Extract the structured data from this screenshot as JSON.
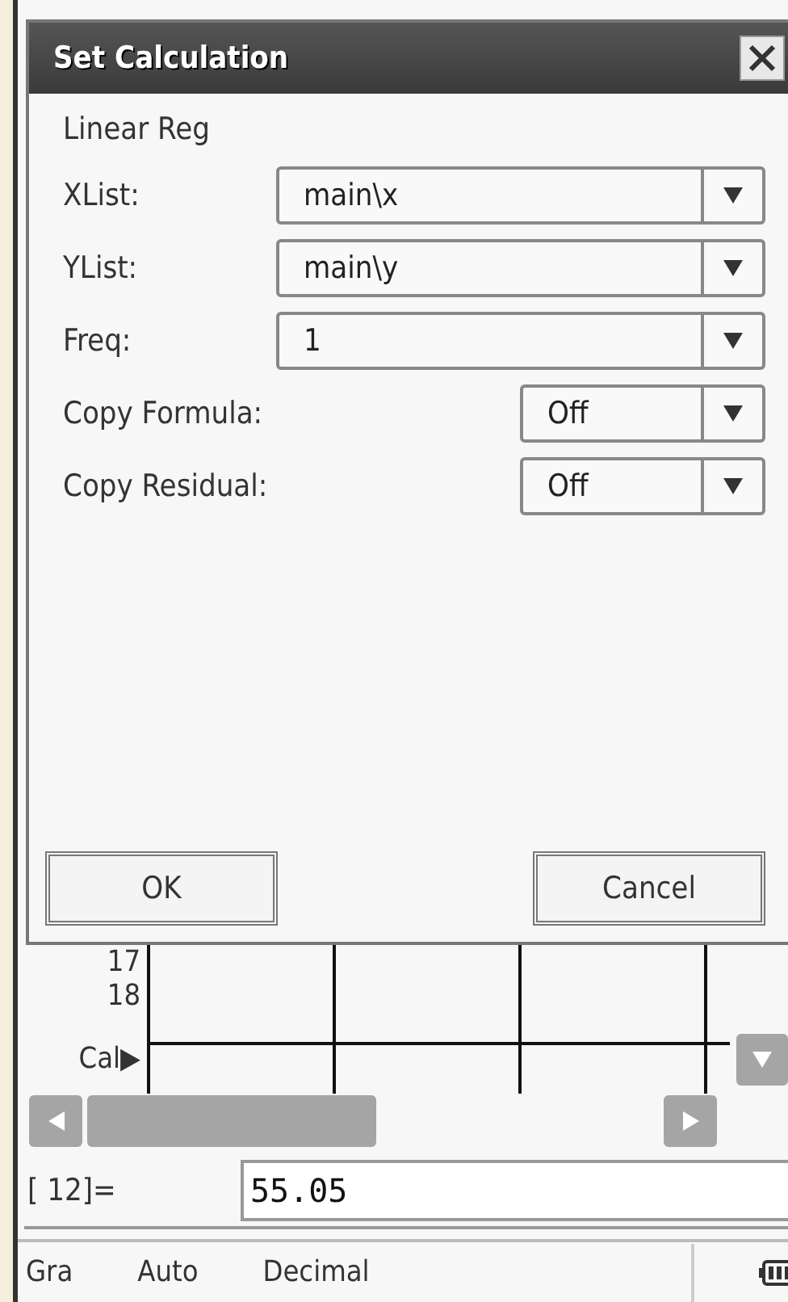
{
  "dialog": {
    "title": "Set Calculation",
    "heading": "Linear Reg",
    "fields": [
      {
        "label": "XList:",
        "value": "main\\x",
        "kind": "wide"
      },
      {
        "label": "YList:",
        "value": "main\\y",
        "kind": "wide"
      },
      {
        "label": "Freq:",
        "value": "1",
        "kind": "wide"
      },
      {
        "label": "Copy Formula:",
        "value": "Off",
        "kind": "narrow"
      },
      {
        "label": "Copy Residual:",
        "value": "Off",
        "kind": "narrow"
      }
    ],
    "buttons": [
      "OK",
      "Cancel"
    ]
  },
  "spreadsheet": {
    "row_labels": [
      "17",
      "18"
    ],
    "calc_label": "Cal▶"
  },
  "entry": {
    "label": "[ 12]=",
    "value": "55.05"
  },
  "status_bar": [
    "Gra",
    "Auto",
    "Decimal"
  ]
}
